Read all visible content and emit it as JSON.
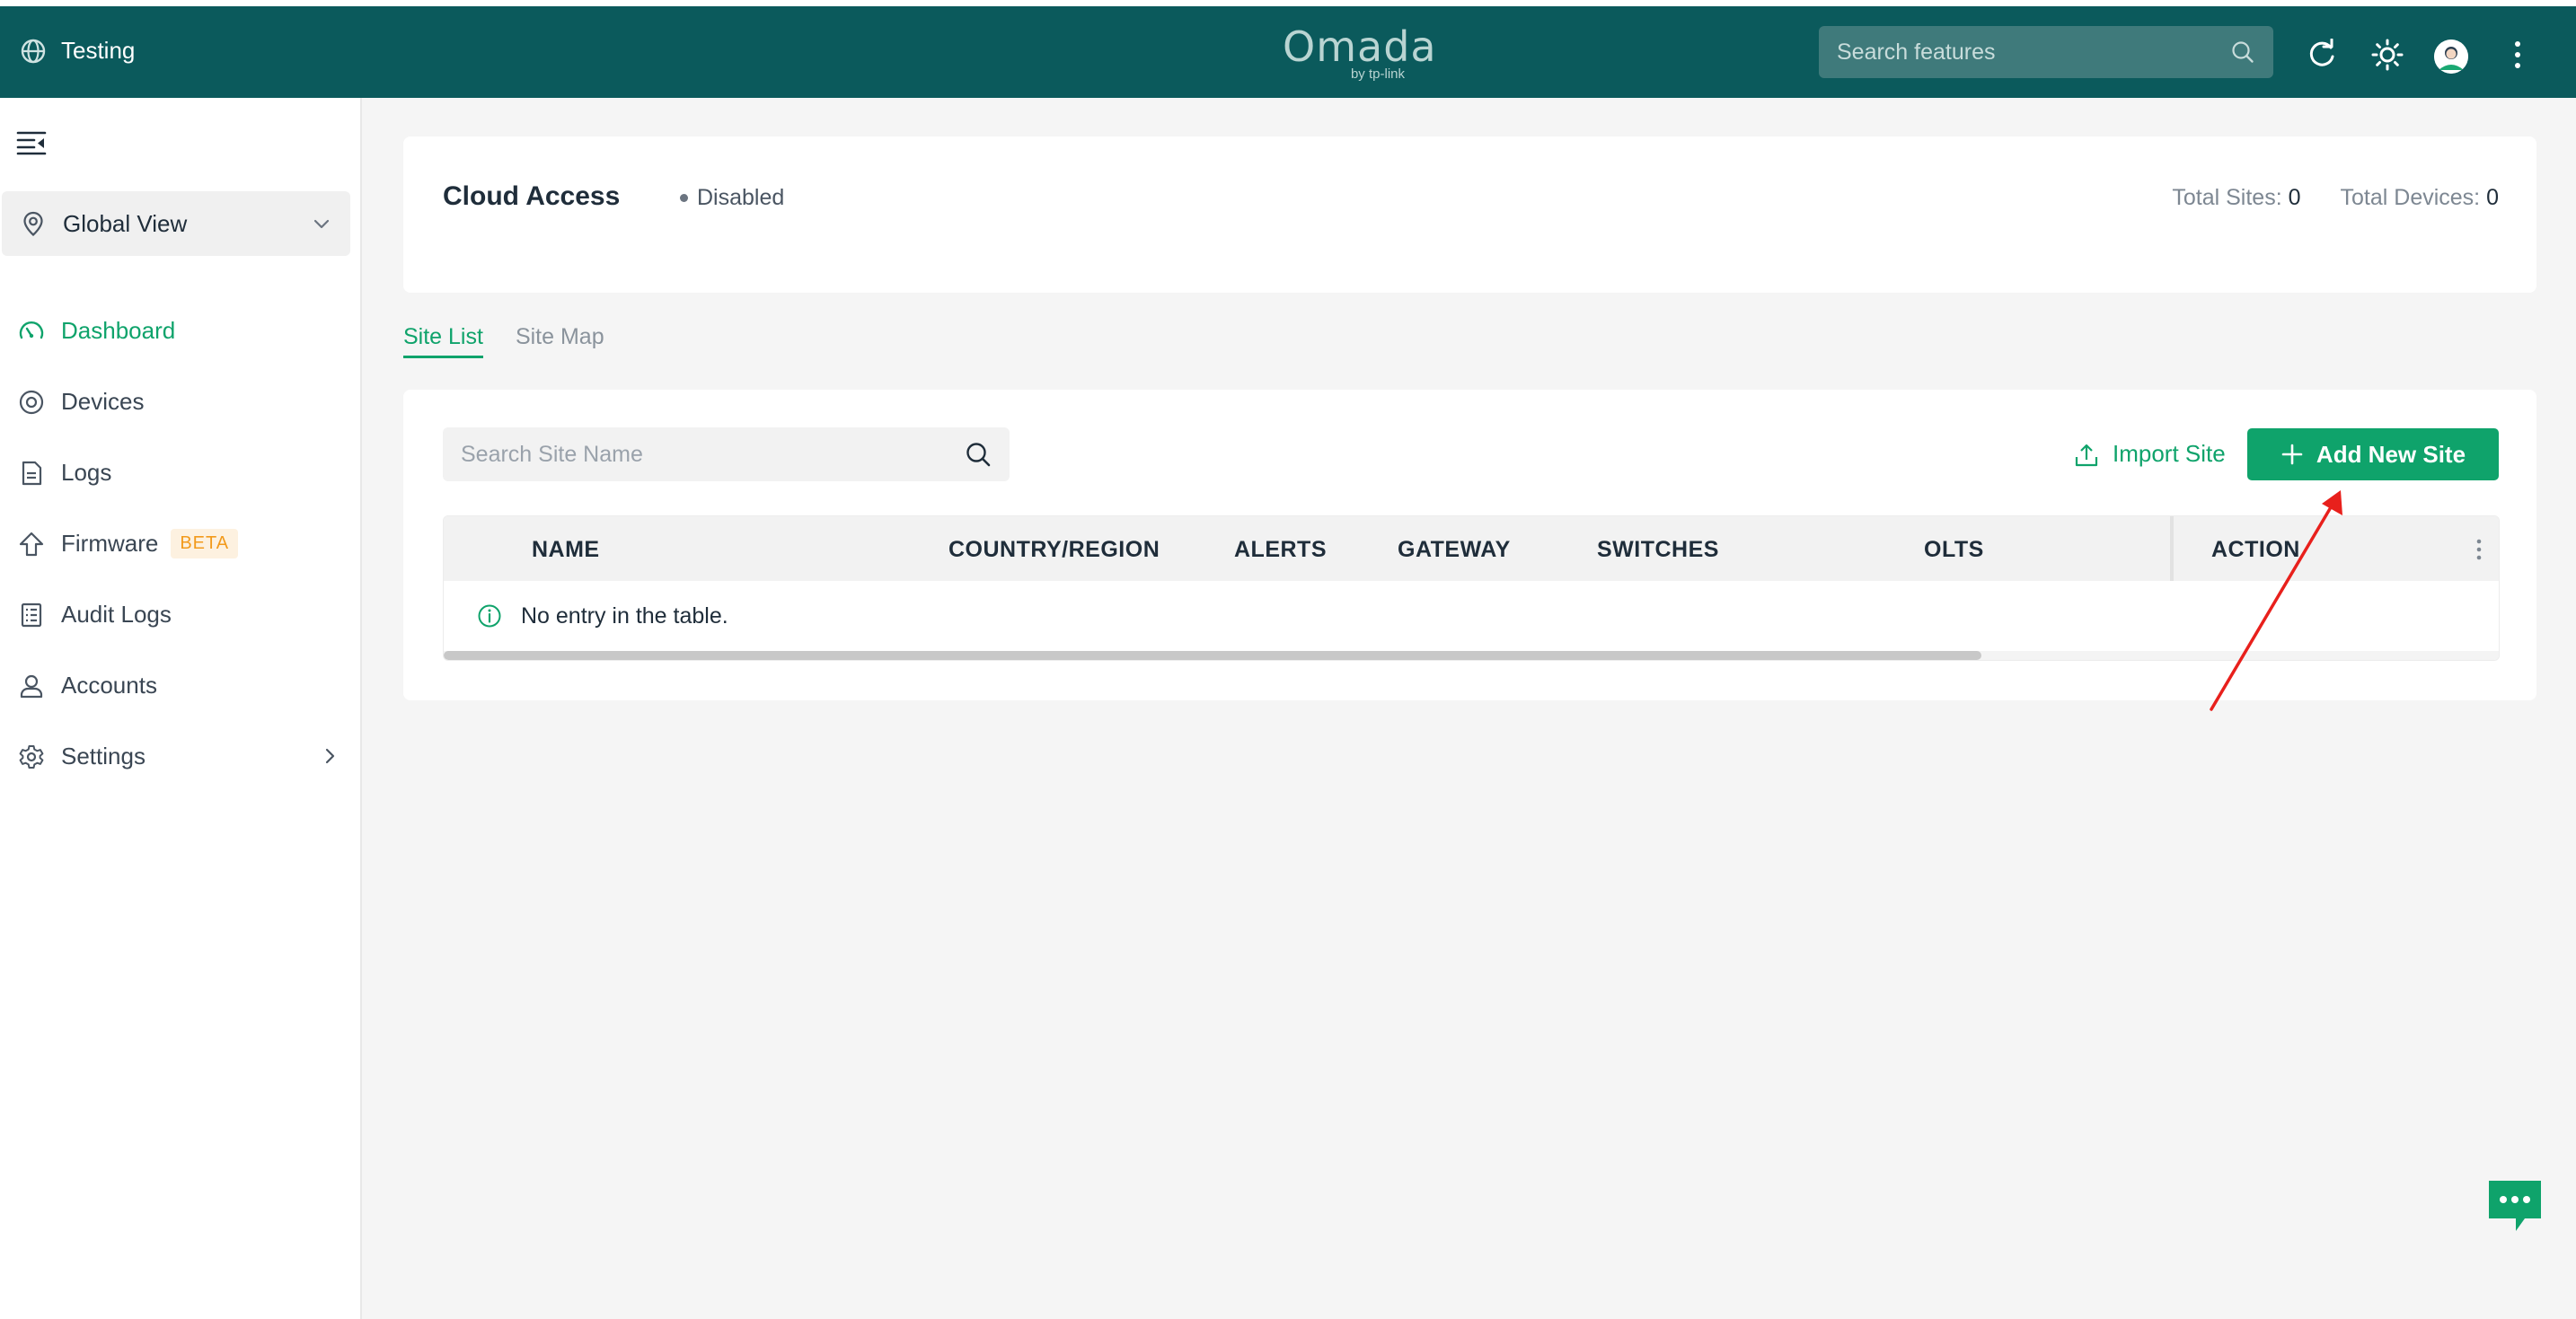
{
  "topbar": {
    "site_name": "Testing",
    "logo_word": "Omada",
    "logo_by": "by tp-link",
    "search_placeholder": "Search features"
  },
  "sidebar": {
    "view_selector": "Global View",
    "items": [
      {
        "label": "Dashboard",
        "active": true
      },
      {
        "label": "Devices"
      },
      {
        "label": "Logs"
      },
      {
        "label": "Firmware",
        "badge": "BETA"
      },
      {
        "label": "Audit Logs"
      },
      {
        "label": "Accounts"
      },
      {
        "label": "Settings"
      }
    ]
  },
  "cloud": {
    "title": "Cloud Access",
    "status": "Disabled",
    "total_sites_label": "Total Sites:",
    "total_sites_value": "0",
    "total_devices_label": "Total Devices:",
    "total_devices_value": "0"
  },
  "tabs": [
    "Site List",
    "Site Map"
  ],
  "site_list": {
    "search_placeholder": "Search Site Name",
    "import_label": "Import Site",
    "add_label": "Add New Site",
    "columns": [
      "NAME",
      "COUNTRY/REGION",
      "ALERTS",
      "GATEWAY",
      "SWITCHES",
      "OLTS",
      "ACTION"
    ],
    "empty_text": "No entry in the table."
  },
  "colors": {
    "topbar": "#0b5a5c",
    "accent": "#0fa36b",
    "beta": "#f29a1c",
    "annotation": "#e8201c"
  },
  "icons": [
    "globe-icon",
    "refresh-icon",
    "theme-sun-icon",
    "more-vertical-icon",
    "collapse-menu-icon",
    "location-pin-icon",
    "chevron-down-icon",
    "dashboard-icon",
    "devices-icon",
    "logs-icon",
    "firmware-icon",
    "audit-logs-icon",
    "accounts-icon",
    "settings-icon",
    "chevron-right-icon",
    "search-icon",
    "upload-icon",
    "plus-icon",
    "info-icon",
    "chat-icon"
  ]
}
